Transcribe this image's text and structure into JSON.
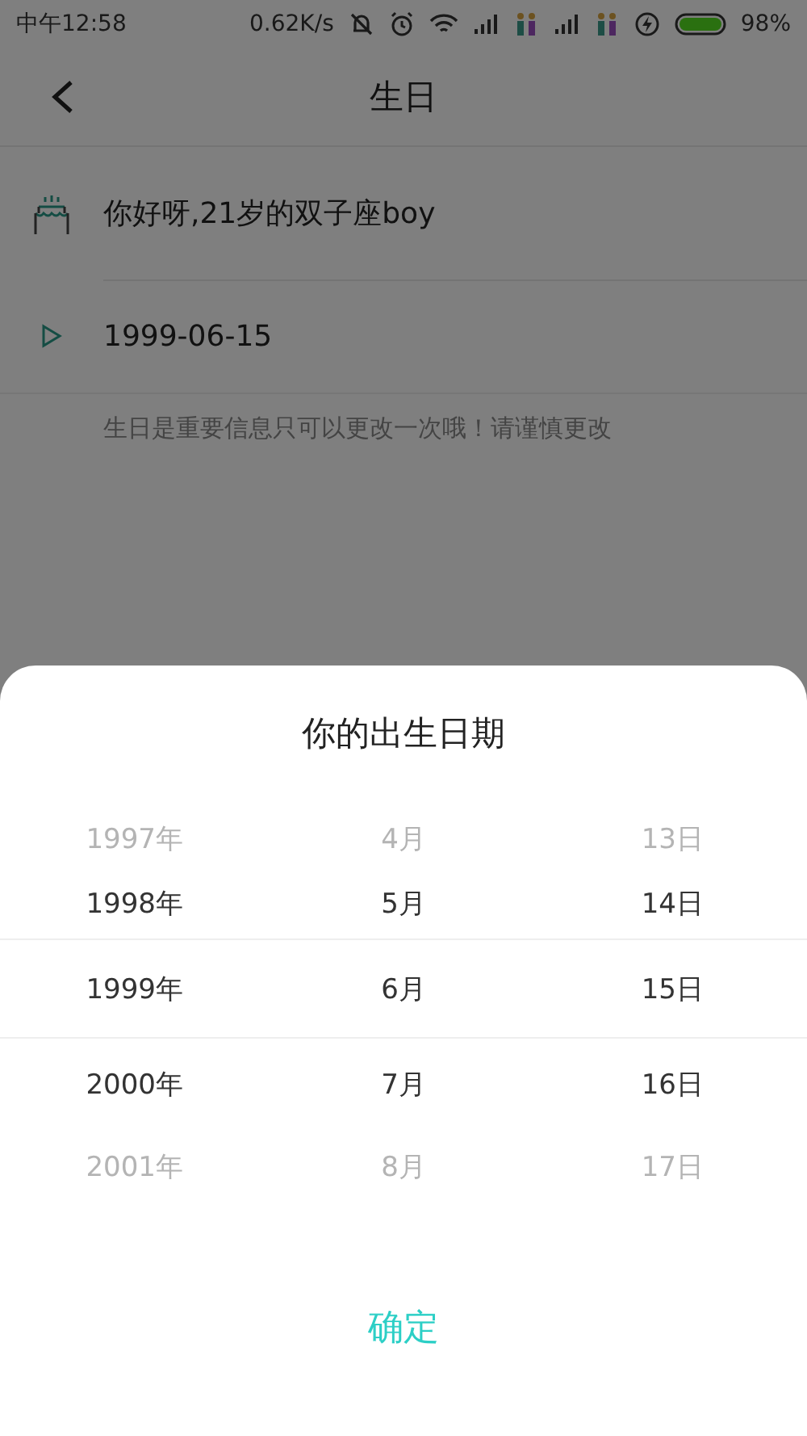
{
  "status_bar": {
    "time": "中午12:58",
    "speed": "0.62K/s",
    "battery": "98%"
  },
  "header": {
    "title": "生日"
  },
  "greeting": "你好呀,21岁的双子座boy",
  "birthday": "1999-06-15",
  "hint": "生日是重要信息只可以更改一次哦！请谨慎更改",
  "sheet": {
    "title": "你的出生日期",
    "confirm": "确定",
    "rows": [
      {
        "year": "1997年",
        "month": "4月",
        "day": "13日",
        "selected": false,
        "faded": true
      },
      {
        "year": "1998年",
        "month": "5月",
        "day": "14日",
        "selected": false,
        "faded": false
      },
      {
        "year": "1999年",
        "month": "6月",
        "day": "15日",
        "selected": true,
        "faded": false
      },
      {
        "year": "2000年",
        "month": "7月",
        "day": "16日",
        "selected": false,
        "faded": false
      },
      {
        "year": "2001年",
        "month": "8月",
        "day": "17日",
        "selected": false,
        "faded": true
      }
    ]
  }
}
